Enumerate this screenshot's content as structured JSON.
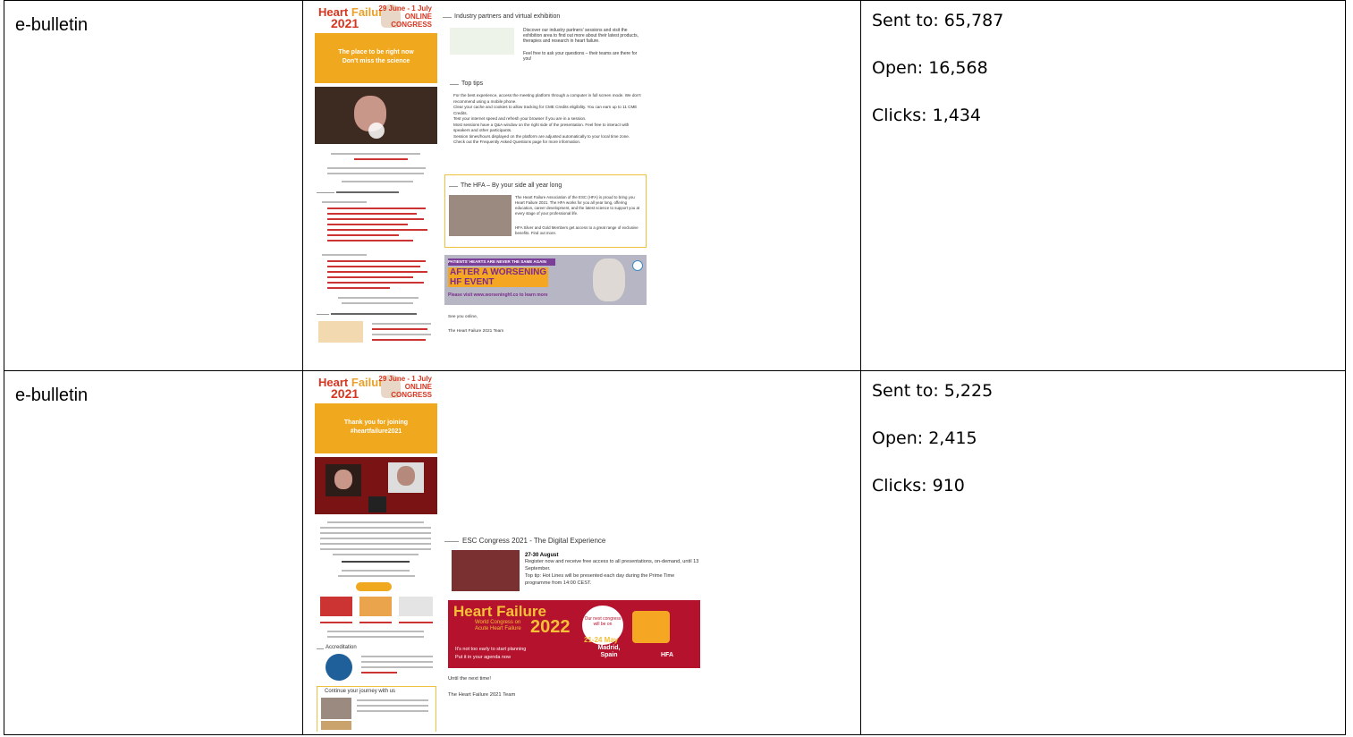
{
  "rows": [
    {
      "type": "e-bulletin",
      "sent": "Sent to: 65,787",
      "open": "Open: 16,568",
      "clicks": "Clicks: 1,434",
      "email_left": {
        "brand_word1": "Heart",
        "brand_word2": "Failure",
        "brand_year": "2021",
        "date": "29 June - 1 July",
        "online": "ONLINE",
        "congress": "CONGRESS",
        "hero_l1": "The place to be right now",
        "hero_l2": "Don't miss the science"
      },
      "email_right": {
        "s1_title": "Industry partners and virtual exhibition",
        "s1_b1": "Discover our industry partners' sessions and visit the exhibition area to find out more about their latest products, therapies and research in heart failure.",
        "s1_b2": "Feel free to ask your questions – their teams are there for you!",
        "s2_title": "Top tips",
        "tips": [
          "For the best experience, access the meeting platform through a computer in full screen mode. We don't recommend using a mobile phone.",
          "Clear your cache and cookies to allow tracking for CME Credits eligibility. You can earn up to 11 CME Credits.",
          "Test your internet speed and refresh your browser if you are in a session.",
          "Most sessions have a Q&A window on the right side of the presentation. Feel free to interact with speakers and other participants.",
          "Session times/hours displayed on the platform are adjusted automatically to your local time zone.",
          "Check out the Frequently Asked Questions page for more information."
        ],
        "s3_title": "The HFA – By your side all year long",
        "s3_p1": "The Heart Failure Association of the ESC (HFA) is proud to bring you Heart Failure 2021. The HFA works for you all year long, offering education, career development, and the latest science to support you at every stage of your professional life.",
        "s3_p2": "HFA Silver and Gold Members get access to a great range of exclusive benefits. Find out more.",
        "ad_top": "PATIENTS' HEARTS ARE NEVER THE SAME AGAIN",
        "ad_l1": "AFTER A WORSENING",
        "ad_l2": "HF EVENT",
        "ad_url": "Please visit www.worseninghf.co to learn more",
        "sign1": "See you online,",
        "sign2": "The Heart Failure 2021 Team"
      }
    },
    {
      "type": "e-bulletin",
      "sent": "Sent to: 5,225",
      "open": "Open: 2,415",
      "clicks": "Clicks: 910",
      "email_left": {
        "brand_word1": "Heart",
        "brand_word2": "Failure",
        "brand_year": "2021",
        "date": "29 June - 1 July",
        "online": "ONLINE",
        "congress": "CONGRESS",
        "hero_l1": "Thank you for joining",
        "hero_l2": "#heartfailure2021",
        "accreditation": "Accreditation",
        "continue": "Continue your journey with us"
      },
      "email_right": {
        "title": "ESC Congress 2021 - The Digital Experience",
        "dates": "27-30 August",
        "p1": "Register now and receive free access to all presentations, on-demand, until 13 September.",
        "p2": "Top tip: Hot Lines will be presented each day during the Prime Time programme from 14:00 CEST.",
        "banner_l1": "Heart Failure",
        "banner_year": "2022",
        "banner_sub": "World Congress on Acute Heart Failure",
        "banner_next": "Our next congress will be on",
        "banner_dates": "21-24 May",
        "banner_city": "Madrid, Spain",
        "banner_b1": "It's not too early to start planning",
        "banner_b2": "Put it in your agenda now",
        "banner_logo": "HFA",
        "closing1": "Until the next time!",
        "closing2": "The Heart Failure 2021 Team"
      }
    }
  ]
}
